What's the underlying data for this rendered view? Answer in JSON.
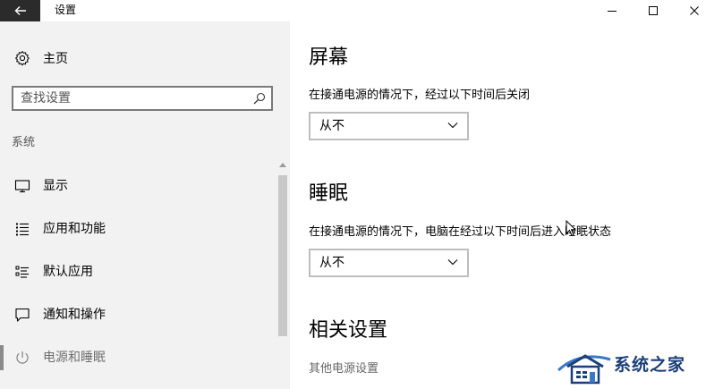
{
  "window": {
    "title": "设置"
  },
  "colors": {
    "back_button_bg": "#2b2b2b",
    "nav_bg": "#f2f2f2",
    "watermark": "#1b3f7a"
  },
  "nav": {
    "home_label": "主页",
    "home_icon": "gear-icon",
    "search_placeholder": "查找设置",
    "section_label": "系统",
    "items": [
      {
        "label": "显示",
        "icon": "monitor-icon",
        "selected": false
      },
      {
        "label": "应用和功能",
        "icon": "list-icon",
        "selected": false
      },
      {
        "label": "默认应用",
        "icon": "default-apps-icon",
        "selected": false
      },
      {
        "label": "通知和操作",
        "icon": "message-icon",
        "selected": false
      },
      {
        "label": "电源和睡眠",
        "icon": "power-icon",
        "selected": true
      }
    ]
  },
  "main": {
    "screen": {
      "title": "屏幕",
      "description": "在接通电源的情况下，经过以下时间后关闭",
      "selected_value": "从不"
    },
    "sleep": {
      "title": "睡眠",
      "description": "在接通电源的情况下，电脑在经过以下时间后进入睡眠状态",
      "selected_value": "从不"
    },
    "related": {
      "title": "相关设置",
      "link": "其他电源设置"
    }
  },
  "watermark": {
    "text": "系统之家"
  }
}
